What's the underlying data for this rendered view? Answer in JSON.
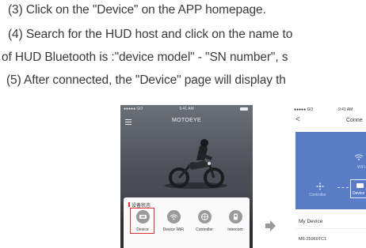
{
  "steps": {
    "step3": "(3) Click on the \"Device\" on the APP homepage.",
    "step4": "(4) Search for the HUD host and click on the name to",
    "step4_cont": "of HUD Bluetooth is :\"device model\" - \"SN number\", s",
    "step5": "(5) After connected, the \"Device\" page will display th"
  },
  "phone1": {
    "status_carrier": "●●●●● GO",
    "status_time": "9:41 AM",
    "app_title": "MOTOEYE",
    "card_label": "设备状态",
    "items": [
      {
        "label": "Device",
        "icon": "device-icon"
      },
      {
        "label": "Device WiFi",
        "icon": "wifi-icon"
      },
      {
        "label": "Controller",
        "icon": "controller-icon"
      },
      {
        "label": "Intercom",
        "icon": "intercom-icon"
      }
    ]
  },
  "phone2": {
    "status_carrier": "●●●●● GO",
    "status_time": "9:41 AM",
    "back": "<",
    "title": "Conne",
    "wifi_label": "WiFi",
    "controller_label": "Controller",
    "device_label": "Device",
    "my_device": "My Device",
    "sn": "M6-25960TC1"
  },
  "colors": {
    "highlight": "#e03030",
    "panel_blue": "#5a7cc6"
  }
}
